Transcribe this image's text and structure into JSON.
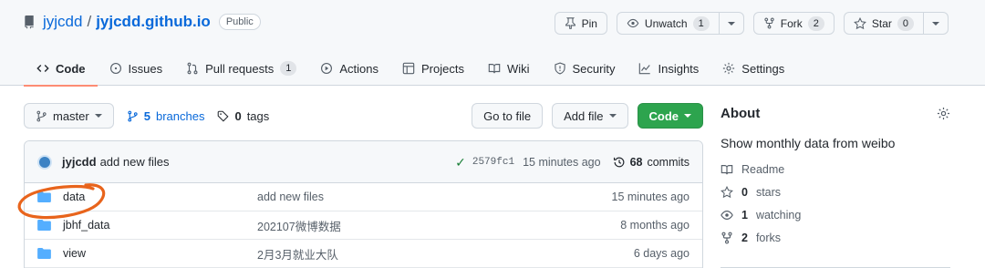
{
  "repo": {
    "owner": "jyjcdd",
    "separator": "/",
    "name": "jyjcdd.github.io",
    "visibility": "Public"
  },
  "actions": {
    "pin": "Pin",
    "unwatch": "Unwatch",
    "unwatch_count": "1",
    "fork": "Fork",
    "fork_count": "2",
    "star": "Star",
    "star_count": "0"
  },
  "tabs": [
    {
      "label": "Code",
      "icon": "code-icon"
    },
    {
      "label": "Issues",
      "icon": "issue-icon"
    },
    {
      "label": "Pull requests",
      "icon": "pull-request-icon",
      "count": "1"
    },
    {
      "label": "Actions",
      "icon": "play-icon"
    },
    {
      "label": "Projects",
      "icon": "table-icon"
    },
    {
      "label": "Wiki",
      "icon": "book-icon"
    },
    {
      "label": "Security",
      "icon": "shield-icon"
    },
    {
      "label": "Insights",
      "icon": "graph-icon"
    },
    {
      "label": "Settings",
      "icon": "gear-icon"
    }
  ],
  "file_nav": {
    "branch": "master",
    "branches_count": "5",
    "branches_label": "branches",
    "tags_count": "0",
    "tags_label": "tags",
    "go_to_file": "Go to file",
    "add_file": "Add file",
    "code": "Code"
  },
  "latest_commit": {
    "author": "jyjcdd",
    "message": "add new files",
    "check": "✓",
    "sha": "2579fc1",
    "time": "15 minutes ago",
    "commits_count": "68",
    "commits_label": "commits"
  },
  "files": [
    {
      "name": "data",
      "message": "add new files",
      "age": "15 minutes ago"
    },
    {
      "name": "jbhf_data",
      "message": "202107微博数据",
      "age": "8 months ago"
    },
    {
      "name": "view",
      "message": "2月3月就业大队",
      "age": "6 days ago"
    }
  ],
  "about": {
    "title": "About",
    "description": "Show monthly data from weibo",
    "readme": "Readme",
    "stars_count": "0",
    "stars_label": "stars",
    "watching_count": "1",
    "watching_label": "watching",
    "forks_count": "2",
    "forks_label": "forks"
  },
  "colors": {
    "link": "#0969da",
    "primary_button": "#2da44e",
    "active_tab_underline": "#fd8c73",
    "folder": "#54aeff",
    "annotation_circle": "#e8641c"
  }
}
